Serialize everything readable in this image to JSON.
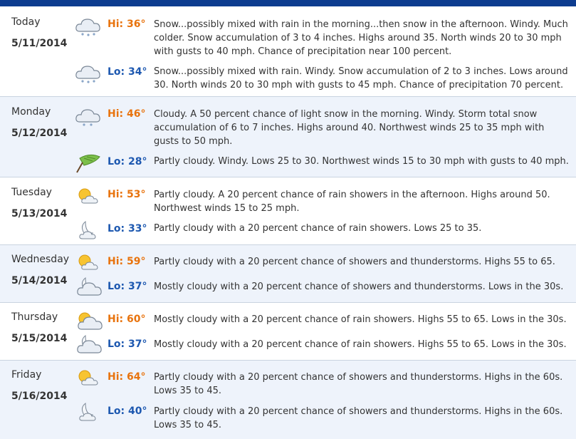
{
  "colors": {
    "topbar": "#0d3c8f",
    "hi": "#e8730d",
    "lo": "#1d58b0",
    "alt_row": "#eef3fb"
  },
  "days": [
    {
      "name": "Today",
      "date": "5/11/2014",
      "hi": {
        "label": "Hi: 36°",
        "icon": "snow-icon",
        "text": "Snow...possibly mixed with rain in the morning...then snow in the afternoon. Windy. Much colder. Snow accumulation of 3 to 4 inches. Highs around 35. North winds 20 to 30 mph with gusts to 40 mph. Chance of precipitation near 100 percent."
      },
      "lo": {
        "label": "Lo: 34°",
        "icon": "snow-icon",
        "text": "Snow...possibly mixed with rain. Windy. Snow accumulation of 2 to 3 inches. Lows around 30. North winds 20 to 30 mph with gusts to 45 mph. Chance of precipitation 70 percent."
      }
    },
    {
      "name": "Monday",
      "date": "5/12/2014",
      "hi": {
        "label": "Hi: 46°",
        "icon": "snow-icon",
        "text": "Cloudy. A 50 percent chance of light snow in the morning. Windy. Storm total snow accumulation of 6 to 7 inches. Highs around 40. Northwest winds 25 to 35 mph with gusts to 50 mph."
      },
      "lo": {
        "label": "Lo: 28°",
        "icon": "windy-icon",
        "text": "Partly cloudy. Windy. Lows 25 to 30. Northwest winds 15 to 30 mph with gusts to 40 mph."
      }
    },
    {
      "name": "Tuesday",
      "date": "5/13/2014",
      "hi": {
        "label": "Hi: 53°",
        "icon": "partly-cloudy-day-icon",
        "text": "Partly cloudy. A 20 percent chance of rain showers in the afternoon. Highs around 50. Northwest winds 15 to 25 mph."
      },
      "lo": {
        "label": "Lo: 33°",
        "icon": "partly-cloudy-night-icon",
        "text": "Partly cloudy with a 20 percent chance of rain showers. Lows 25 to 35."
      }
    },
    {
      "name": "Wednesday",
      "date": "5/14/2014",
      "hi": {
        "label": "Hi: 59°",
        "icon": "partly-cloudy-day-icon",
        "text": "Partly cloudy with a 20 percent chance of showers and thunderstorms. Highs 55 to 65."
      },
      "lo": {
        "label": "Lo: 37°",
        "icon": "mostly-cloudy-night-icon",
        "text": "Mostly cloudy with a 20 percent chance of showers and thunderstorms. Lows in the 30s."
      }
    },
    {
      "name": "Thursday",
      "date": "5/15/2014",
      "hi": {
        "label": "Hi: 60°",
        "icon": "mostly-cloudy-day-icon",
        "text": "Mostly cloudy with a 20 percent chance of rain showers. Highs 55 to 65. Lows in the 30s."
      },
      "lo": {
        "label": "Lo: 37°",
        "icon": "mostly-cloudy-night-icon",
        "text": "Mostly cloudy with a 20 percent chance of rain showers. Highs 55 to 65. Lows in the 30s."
      }
    },
    {
      "name": "Friday",
      "date": "5/16/2014",
      "hi": {
        "label": "Hi: 64°",
        "icon": "partly-cloudy-day-icon",
        "text": "Partly cloudy with a 20 percent chance of showers and thunderstorms. Highs in the 60s. Lows 35 to 45."
      },
      "lo": {
        "label": "Lo: 40°",
        "icon": "partly-cloudy-night-icon",
        "text": "Partly cloudy with a 20 percent chance of showers and thunderstorms. Highs in the 60s. Lows 35 to 45."
      }
    }
  ]
}
